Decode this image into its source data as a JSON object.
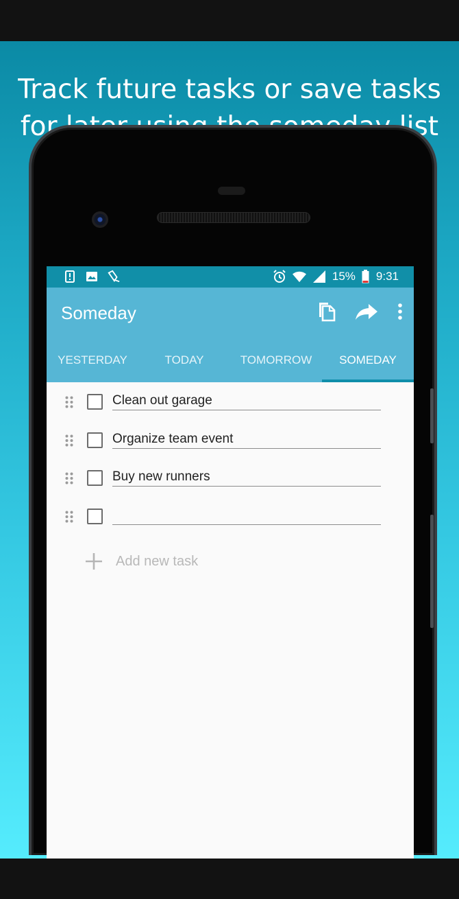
{
  "promo": {
    "headline_line1": "Track future tasks or save tasks",
    "headline_line2": "for later using the someday list"
  },
  "statusbar": {
    "battery": "15%",
    "time": "9:31",
    "icons_left": [
      "notification-icon",
      "image-icon",
      "tasks-app-icon"
    ],
    "icons_right": [
      "alarm-icon",
      "wifi-icon",
      "signal-icon",
      "battery-icon"
    ]
  },
  "toolbar": {
    "title": "Someday",
    "actions": [
      "copy-icon",
      "share-icon",
      "more-vert-icon"
    ]
  },
  "tabs": [
    {
      "label": "YESTERDAY",
      "active": false
    },
    {
      "label": "TODAY",
      "active": false
    },
    {
      "label": "TOMORROW",
      "active": false
    },
    {
      "label": "SOMEDAY",
      "active": true
    }
  ],
  "tasks": [
    {
      "text": "Clean out garage",
      "checked": false
    },
    {
      "text": "Organize team event",
      "checked": false
    },
    {
      "text": "Buy new runners",
      "checked": false
    },
    {
      "text": "",
      "checked": false
    }
  ],
  "add_task": {
    "label": "Add new task"
  },
  "colors": {
    "statusbar": "#118fa8",
    "toolbar": "#56b6d5",
    "tab_indicator": "#0f8eaa",
    "gradient_top": "#0b8aa5",
    "gradient_bottom": "#55ecfd"
  }
}
